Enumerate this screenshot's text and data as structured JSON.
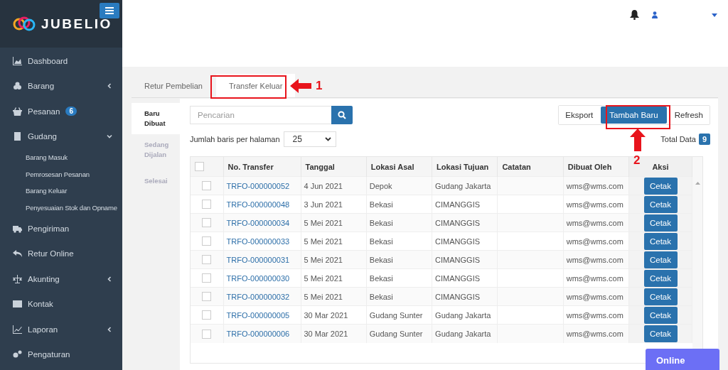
{
  "brand": {
    "name": "JUBELIO"
  },
  "sidebar": {
    "items": [
      {
        "kind": "link",
        "label": "Dashboard"
      },
      {
        "kind": "menu",
        "label": "Barang",
        "expanded": false
      },
      {
        "kind": "link",
        "label": "Pesanan",
        "badge": "6"
      },
      {
        "kind": "menu",
        "label": "Gudang",
        "expanded": true,
        "children": [
          {
            "label": "Barang Masuk"
          },
          {
            "label": "Pemrosesan Pesanan"
          },
          {
            "label": "Barang Keluar"
          },
          {
            "label": "Penyesuaian Stok dan Opname"
          }
        ]
      },
      {
        "kind": "link",
        "label": "Pengiriman"
      },
      {
        "kind": "link",
        "label": "Retur Online"
      },
      {
        "kind": "menu",
        "label": "Akunting",
        "expanded": false
      },
      {
        "kind": "link",
        "label": "Kontak"
      },
      {
        "kind": "menu",
        "label": "Laporan",
        "expanded": false
      },
      {
        "kind": "link",
        "label": "Pengaturan"
      }
    ]
  },
  "tabs": [
    {
      "label": "Retur Pembelian",
      "selected": false
    },
    {
      "label": "Transfer Keluar",
      "selected": true
    }
  ],
  "status_tabs": [
    {
      "label": "Baru Dibuat",
      "selected": true
    },
    {
      "label": "Sedang Dijalan",
      "selected": false
    },
    {
      "label": "Selesai",
      "selected": false
    }
  ],
  "search": {
    "placeholder": "Pencarian"
  },
  "buttons": [
    {
      "label": "Eksport",
      "kind": "default"
    },
    {
      "label": "Tambah Baru",
      "kind": "primary"
    },
    {
      "label": "Refresh",
      "kind": "default"
    }
  ],
  "page_size": {
    "label": "Jumlah baris per halaman",
    "value": "25"
  },
  "total": {
    "label": "Total Data",
    "count": "9"
  },
  "table": {
    "header_checked": false,
    "columns": [
      "No. Transfer",
      "Tanggal",
      "Lokasi Asal",
      "Lokasi Tujuan",
      "Catatan",
      "Dibuat Oleh",
      "Aksi"
    ],
    "rows": [
      {
        "checked": false,
        "no": "TRFO-000000052",
        "date": "4 Jun 2021",
        "from": "Depok",
        "to": "Gudang Jakarta",
        "by": "wms@wms.com",
        "action": "Cetak"
      },
      {
        "checked": false,
        "no": "TRFO-000000048",
        "date": "3 Jun 2021",
        "from": "Bekasi",
        "to": "CIMANGGIS",
        "by": "wms@wms.com",
        "action": "Cetak"
      },
      {
        "checked": false,
        "no": "TRFO-000000034",
        "date": "5 Mei 2021",
        "from": "Bekasi",
        "to": "CIMANGGIS",
        "by": "wms@wms.com",
        "action": "Cetak"
      },
      {
        "checked": false,
        "no": "TRFO-000000033",
        "date": "5 Mei 2021",
        "from": "Bekasi",
        "to": "CIMANGGIS",
        "by": "wms@wms.com",
        "action": "Cetak"
      },
      {
        "checked": false,
        "no": "TRFO-000000031",
        "date": "5 Mei 2021",
        "from": "Bekasi",
        "to": "CIMANGGIS",
        "by": "wms@wms.com",
        "action": "Cetak"
      },
      {
        "checked": false,
        "no": "TRFO-000000030",
        "date": "5 Mei 2021",
        "from": "Bekasi",
        "to": "CIMANGGIS",
        "by": "wms@wms.com",
        "action": "Cetak"
      },
      {
        "checked": false,
        "no": "TRFO-000000032",
        "date": "5 Mei 2021",
        "from": "Bekasi",
        "to": "CIMANGGIS",
        "by": "wms@wms.com",
        "action": "Cetak"
      },
      {
        "checked": false,
        "no": "TRFO-000000005",
        "date": "30 Mar 2021",
        "from": "Gudang Sunter",
        "to": "Gudang Jakarta",
        "by": "wms@wms.com",
        "action": "Cetak"
      },
      {
        "checked": false,
        "no": "TRFO-000000006",
        "date": "30 Mar 2021",
        "from": "Gudang Sunter",
        "to": "Gudang Jakarta",
        "by": "wms@wms.com",
        "action": "Cetak"
      }
    ]
  },
  "chat": {
    "label": "Online"
  },
  "annotations": [
    {
      "label": "1",
      "kind": "left"
    },
    {
      "label": "2",
      "kind": "up"
    }
  ]
}
